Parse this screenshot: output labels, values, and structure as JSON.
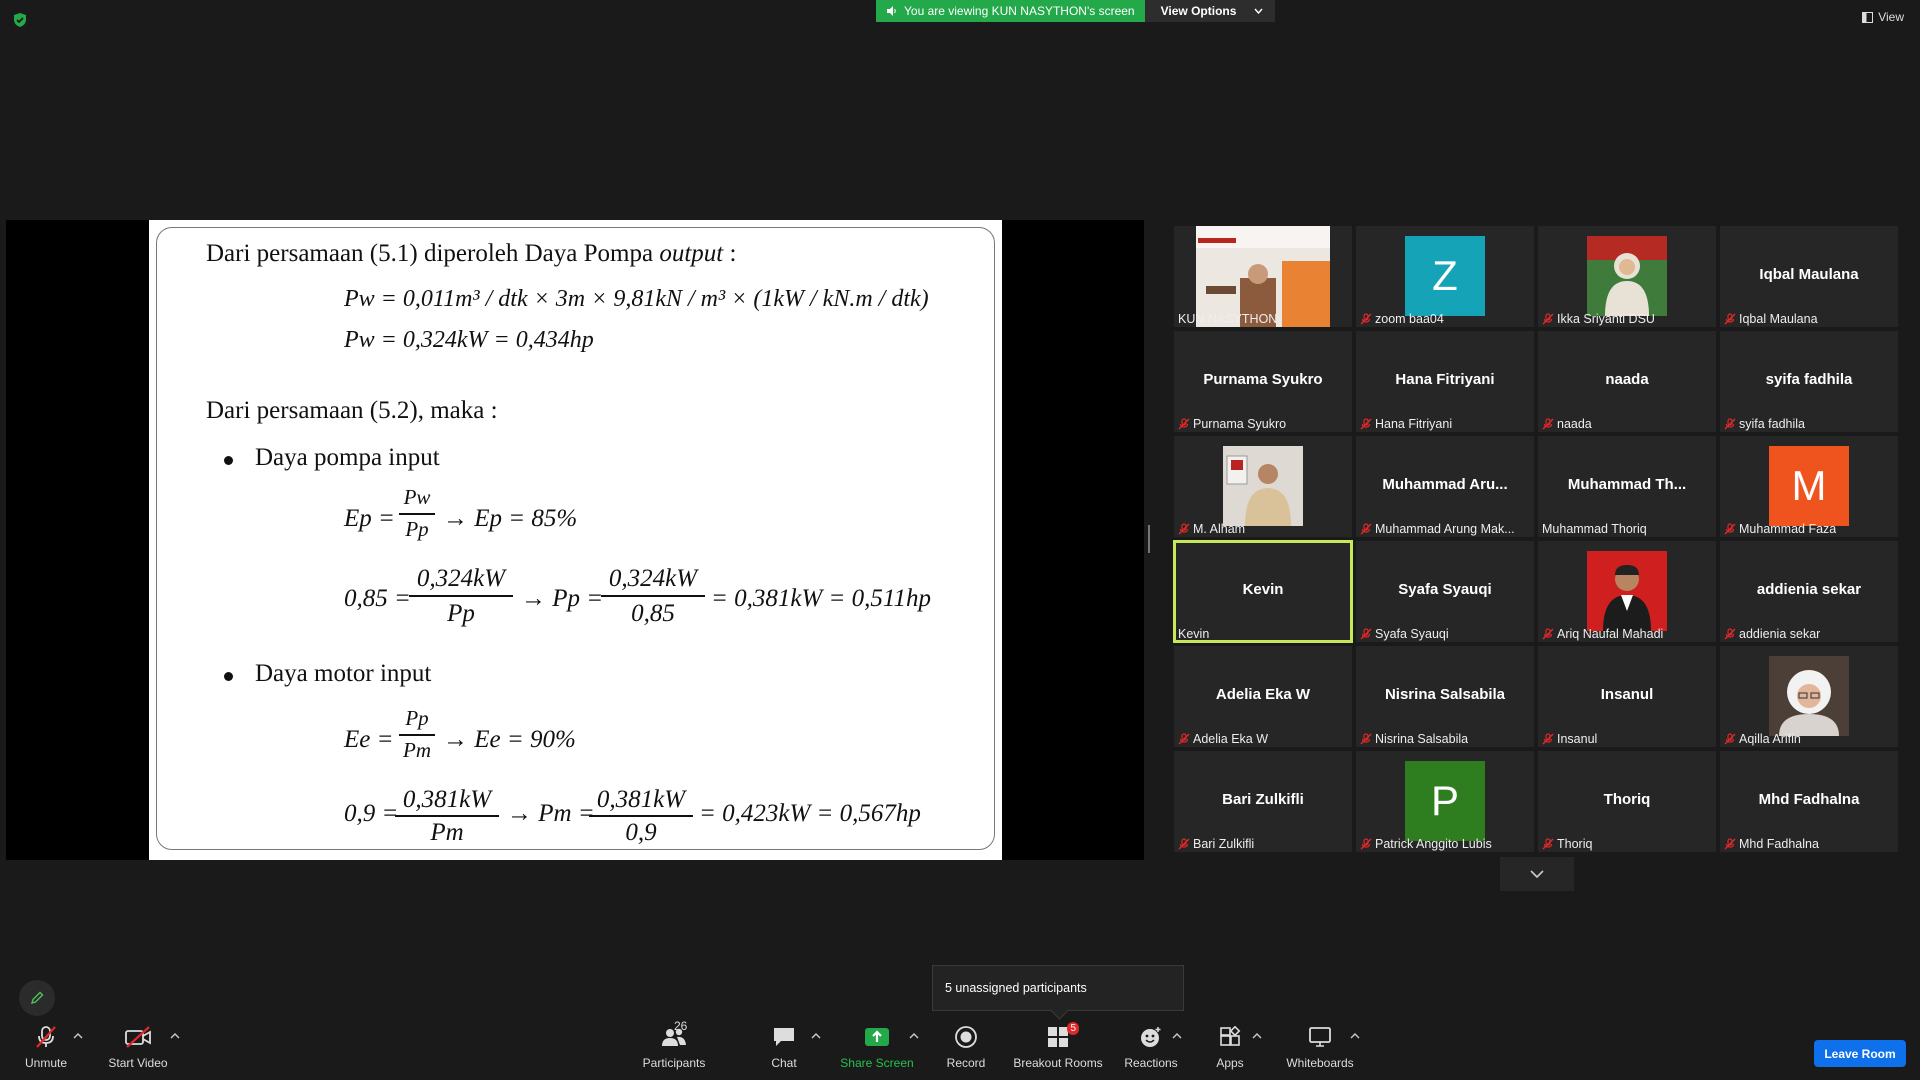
{
  "banner": {
    "viewing_text": "You are viewing KUN NASYTHON's screen",
    "view_options": "View Options"
  },
  "top_right": {
    "view_label": "View"
  },
  "slide": {
    "line1_a": "Dari persamaan (5.1) diperoleh Daya Pompa ",
    "line1_b": "output",
    "line1_c": " :",
    "eq1": "Pw = 0,011m³ / dtk × 3m × 9,81kN / m³ × (1kW / kN.m / dtk)",
    "eq2": "Pw = 0,324kW = 0,434hp",
    "line2": "Dari persamaan (5.2), maka :",
    "bullet1": "Daya pompa input",
    "eq3_lhs": "Ep =",
    "eq3_num": "Pw",
    "eq3_den": "Pp",
    "eq3_rhs": "→ Ep = 85%",
    "eq4_lhs": "0,85 =",
    "eq4_num1": "0,324kW",
    "eq4_den1": "Pp",
    "eq4_mid": "→ Pp =",
    "eq4_num2": "0,324kW",
    "eq4_den2": "0,85",
    "eq4_rhs": "= 0,381kW = 0,511hp",
    "bullet2": "Daya motor input",
    "eq5_lhs": "Ee =",
    "eq5_num": "Pp",
    "eq5_den": "Pm",
    "eq5_rhs": "→ Ee = 90%",
    "eq6_lhs": "0,9 =",
    "eq6_num1": "0,381kW",
    "eq6_den1": "Pm",
    "eq6_mid": "→ Pm =",
    "eq6_num2": "0,381kW",
    "eq6_den2": "0,9",
    "eq6_rhs": "= 0,423kW = 0,567hp"
  },
  "participants": [
    {
      "label": "KUN NASYTHON",
      "muted": false,
      "display": "photo"
    },
    {
      "label": "zoom baa04",
      "muted": true,
      "display": "letter",
      "letter": "Z",
      "color": "#15a3b8"
    },
    {
      "label": "Ikka Sriyanti DSU",
      "muted": true,
      "display": "photo"
    },
    {
      "label": "Iqbal Maulana",
      "muted": true,
      "display": "name",
      "name": "Iqbal Maulana"
    },
    {
      "label": "Purnama Syukro",
      "muted": true,
      "display": "name",
      "name": "Purnama Syukro"
    },
    {
      "label": "Hana Fitriyani",
      "muted": true,
      "display": "name",
      "name": "Hana Fitriyani"
    },
    {
      "label": "naada",
      "muted": true,
      "display": "name",
      "name": "naada"
    },
    {
      "label": "syifa fadhila",
      "muted": true,
      "display": "name",
      "name": "syifa fadhila"
    },
    {
      "label": "M. Alham",
      "muted": true,
      "display": "photo"
    },
    {
      "label": "Muhammad Arung Mak...",
      "muted": true,
      "display": "name",
      "name": "Muhammad  Aru..."
    },
    {
      "label": "Muhammad Thoriq",
      "muted": false,
      "display": "name",
      "name": "Muhammad  Th..."
    },
    {
      "label": "Muhammad Faza",
      "muted": true,
      "display": "letter",
      "letter": "M",
      "color": "#f0541e"
    },
    {
      "label": "Kevin",
      "muted": false,
      "display": "name",
      "name": "Kevin",
      "active": true
    },
    {
      "label": "Syafa Syauqi",
      "muted": true,
      "display": "name",
      "name": "Syafa Syauqi"
    },
    {
      "label": "Ariq Naufal Mahadi",
      "muted": true,
      "display": "photo"
    },
    {
      "label": "addienia sekar",
      "muted": true,
      "display": "name",
      "name": "addienia sekar"
    },
    {
      "label": "Adelia Eka W",
      "muted": true,
      "display": "name",
      "name": "Adelia Eka W"
    },
    {
      "label": "Nisrina Salsabila",
      "muted": true,
      "display": "name",
      "name": "Nisrina Salsabila"
    },
    {
      "label": "Insanul",
      "muted": true,
      "display": "name",
      "name": "Insanul"
    },
    {
      "label": "Aqilla Arifin",
      "muted": true,
      "display": "photo"
    },
    {
      "label": "Bari Zulkifli",
      "muted": true,
      "display": "name",
      "name": "Bari Zulkifli"
    },
    {
      "label": "Patrick Anggito Lubis",
      "muted": true,
      "display": "letter",
      "letter": "P",
      "color": "#2e7d1f"
    },
    {
      "label": "Thoriq",
      "muted": true,
      "display": "name",
      "name": "Thoriq"
    },
    {
      "label": "Mhd Fadhalna",
      "muted": true,
      "display": "name",
      "name": "Mhd Fadhalna"
    }
  ],
  "tooltip": {
    "text": "5 unassigned participants"
  },
  "toolbar": {
    "unmute": "Unmute",
    "start_video": "Start Video",
    "participants": "Participants",
    "participants_count": "26",
    "chat": "Chat",
    "share_screen": "Share Screen",
    "record": "Record",
    "breakout_rooms": "Breakout Rooms",
    "breakout_badge": "5",
    "reactions": "Reactions",
    "apps": "Apps",
    "whiteboards": "Whiteboards",
    "leave_room": "Leave Room"
  }
}
